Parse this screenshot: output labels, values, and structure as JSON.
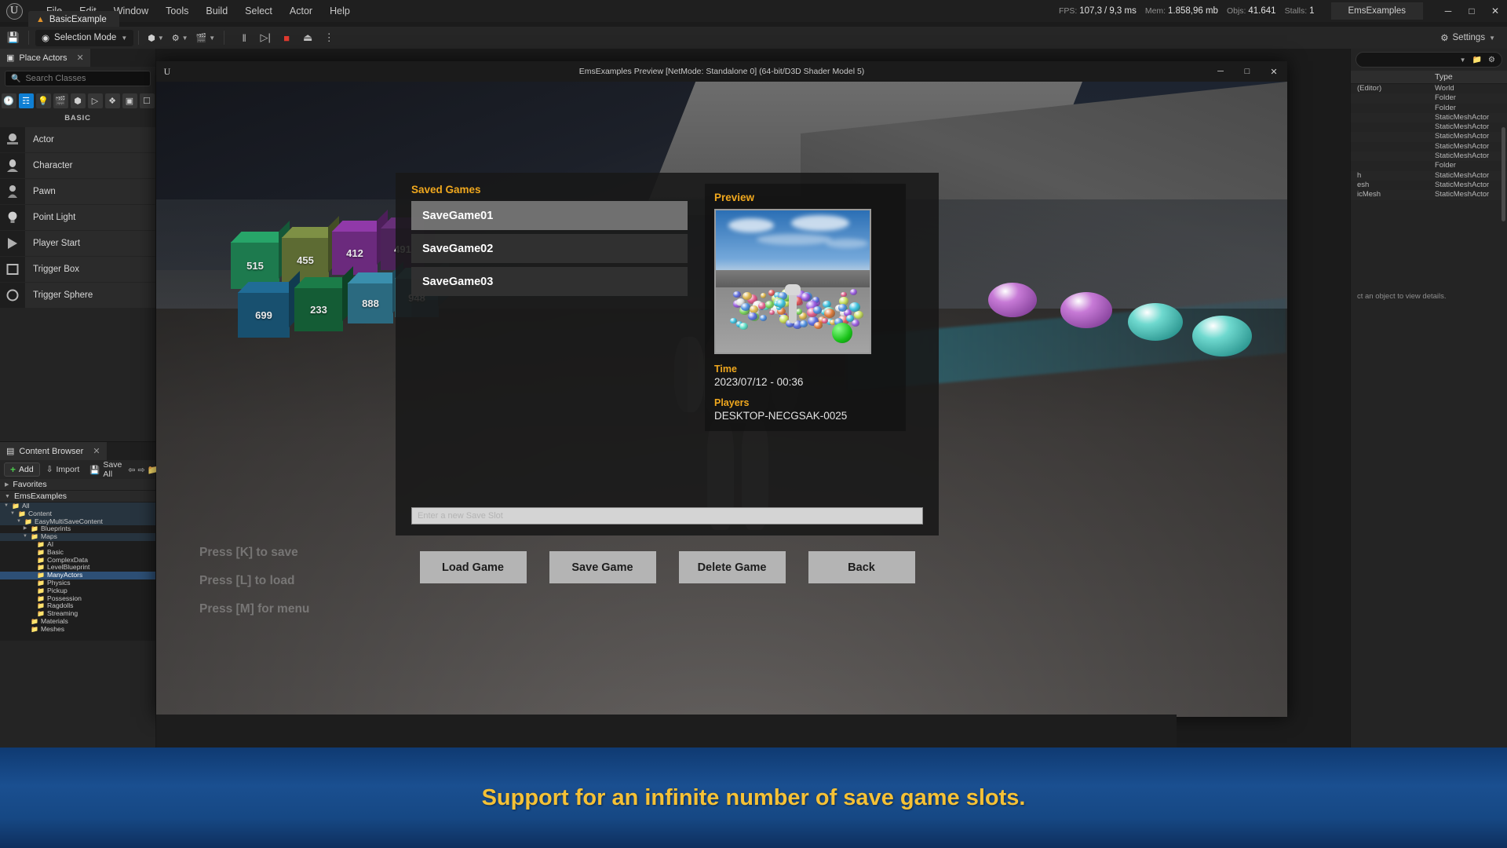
{
  "app": {
    "title": "EmsExamples",
    "logo_glyph": "U"
  },
  "menubar": {
    "items": [
      "File",
      "Edit",
      "Window",
      "Tools",
      "Build",
      "Select",
      "Actor",
      "Help"
    ]
  },
  "level_tab": {
    "label": "BasicExample"
  },
  "stats": {
    "fps_label": "FPS:",
    "fps_value": "107,3",
    "frametime": "/ 9,3 ms",
    "mem_label": "Mem:",
    "mem_value": "1.858,96 mb",
    "objs_label": "Objs:",
    "objs_value": "41.641",
    "stalls_label": "Stalls:",
    "stalls_value": "1"
  },
  "window_controls": {
    "minimize": "─",
    "maximize": "□",
    "close": "✕"
  },
  "toolbar": {
    "save_icon": "save-icon",
    "selection_mode": "Selection Mode",
    "add_actor_icon": "add-actor-icon",
    "blueprints_icon": "blueprints-icon",
    "cinematics_icon": "cinematics-icon",
    "pause": "‖",
    "step": "▷|",
    "stop": "■",
    "eject": "⏏",
    "more": "⋮",
    "settings": "Settings"
  },
  "place_actors": {
    "tab_label": "Place Actors",
    "close": "✕",
    "search_placeholder": "Search Classes",
    "category_icons": [
      "recently-placed-icon",
      "basic-icon",
      "lights-icon",
      "cinematic-icon",
      "visual-effects-icon",
      "geometry-icon",
      "volumes-icon",
      "all-classes-icon",
      "shapes-icon"
    ],
    "active_category_index": 1,
    "section_label": "BASIC",
    "items": [
      {
        "label": "Actor",
        "icon": "actor-icon"
      },
      {
        "label": "Character",
        "icon": "character-icon"
      },
      {
        "label": "Pawn",
        "icon": "pawn-icon"
      },
      {
        "label": "Point Light",
        "icon": "point-light-icon"
      },
      {
        "label": "Player Start",
        "icon": "player-start-icon"
      },
      {
        "label": "Trigger Box",
        "icon": "trigger-box-icon"
      },
      {
        "label": "Trigger Sphere",
        "icon": "trigger-sphere-icon"
      }
    ]
  },
  "content_browser": {
    "tab_label": "Content Browser",
    "close": "✕",
    "add_label": "Add",
    "import_label": "Import",
    "save_all_label": "Save All",
    "back_icon": "back-arrow-icon",
    "forward_icon": "forward-arrow-icon",
    "folder_icon": "folder-icon",
    "favorites_label": "Favorites",
    "project_label": "EmsExamples",
    "tree": [
      {
        "label": "All",
        "depth": 0,
        "expanded": true,
        "selected": false
      },
      {
        "label": "Content",
        "depth": 1,
        "expanded": true,
        "selected": false
      },
      {
        "label": "EasyMultiSaveContent",
        "depth": 2,
        "expanded": true,
        "selected": false
      },
      {
        "label": "Blueprints",
        "depth": 3,
        "expanded": false,
        "selected": false
      },
      {
        "label": "Maps",
        "depth": 3,
        "expanded": true,
        "selected": false
      },
      {
        "label": "AI",
        "depth": 4,
        "expanded": null,
        "selected": false
      },
      {
        "label": "Basic",
        "depth": 4,
        "expanded": null,
        "selected": false
      },
      {
        "label": "ComplexData",
        "depth": 4,
        "expanded": null,
        "selected": false
      },
      {
        "label": "LevelBlueprint",
        "depth": 4,
        "expanded": null,
        "selected": false
      },
      {
        "label": "ManyActors",
        "depth": 4,
        "expanded": null,
        "selected": true
      },
      {
        "label": "Physics",
        "depth": 4,
        "expanded": null,
        "selected": false
      },
      {
        "label": "Pickup",
        "depth": 4,
        "expanded": null,
        "selected": false
      },
      {
        "label": "Possession",
        "depth": 4,
        "expanded": null,
        "selected": false
      },
      {
        "label": "Ragdolls",
        "depth": 4,
        "expanded": null,
        "selected": false
      },
      {
        "label": "Streaming",
        "depth": 4,
        "expanded": null,
        "selected": false
      },
      {
        "label": "Materials",
        "depth": 3,
        "expanded": null,
        "selected": false
      },
      {
        "label": "Meshes",
        "depth": 3,
        "expanded": null,
        "selected": false
      }
    ]
  },
  "outliner": {
    "search_placeholder": "",
    "dropdown_icon": "chevron-down-icon",
    "new_folder_icon": "new-folder-icon",
    "settings_icon": "gear-icon",
    "col_name": "",
    "col_type": "Type",
    "rows": [
      {
        "name": "(Editor)",
        "type": "World"
      },
      {
        "name": "",
        "type": "Folder"
      },
      {
        "name": "",
        "type": "Folder"
      },
      {
        "name": "",
        "type": "StaticMeshActor"
      },
      {
        "name": "",
        "type": "StaticMeshActor"
      },
      {
        "name": "",
        "type": "StaticMeshActor"
      },
      {
        "name": "",
        "type": "StaticMeshActor"
      },
      {
        "name": "",
        "type": "StaticMeshActor"
      },
      {
        "name": "",
        "type": "Folder"
      },
      {
        "name": "h",
        "type": "StaticMeshActor"
      },
      {
        "name": "esh",
        "type": "StaticMeshActor"
      },
      {
        "name": "icMesh",
        "type": "StaticMeshActor"
      }
    ],
    "details_placeholder": "ct an object to view details."
  },
  "pie_window": {
    "title": "EmsExamples Preview [NetMode: Standalone 0]  (64-bit/D3D Shader Model 5)",
    "logo_glyph": "U",
    "minimize": "─",
    "maximize": "□",
    "close": "✕"
  },
  "viewport": {
    "hints": [
      "Press [K] to save",
      "Press [L] to load",
      "Press [M] for menu"
    ],
    "cube_labels": [
      "515",
      "455",
      "412",
      "491",
      "699",
      "233",
      "888",
      "948"
    ]
  },
  "save_menu": {
    "saved_games_title": "Saved Games",
    "slots": [
      {
        "name": "SaveGame01",
        "selected": true
      },
      {
        "name": "SaveGame02",
        "selected": false
      },
      {
        "name": "SaveGame03",
        "selected": false
      }
    ],
    "preview_title": "Preview",
    "time_label": "Time",
    "time_value": "2023/07/12 - 00:36",
    "players_label": "Players",
    "players_value": "DESKTOP-NECGSAK-0025",
    "name_input_placeholder": "Enter a new Save Slot",
    "name_input_value": "",
    "buttons": [
      {
        "label": "Load Game"
      },
      {
        "label": "Save Game"
      },
      {
        "label": "Delete Game"
      },
      {
        "label": "Back"
      }
    ],
    "accent_color": "#f0a81e"
  },
  "banner": {
    "text": "Support for an infinite number of save game slots.",
    "text_color": "#f5c136",
    "bg_color": "#1a4f90"
  }
}
